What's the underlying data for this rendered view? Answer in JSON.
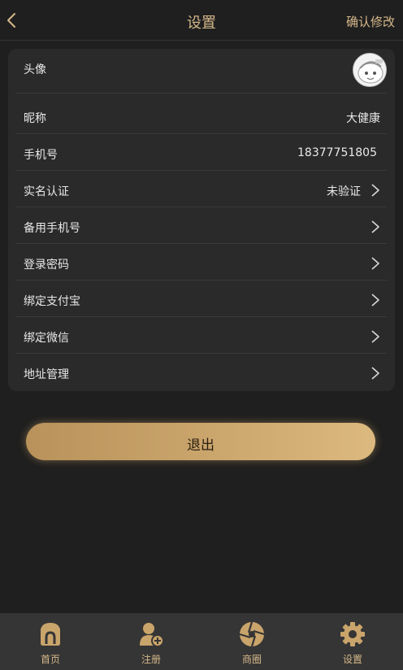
{
  "header": {
    "title": "设置",
    "confirm_label": "确认修改"
  },
  "settings": {
    "avatar_label": "头像",
    "nickname_label": "昵称",
    "nickname_value": "大健康",
    "phone_label": "手机号",
    "phone_value": "18377751805",
    "realname_label": "实名认证",
    "realname_value": "未验证",
    "backup_phone_label": "备用手机号",
    "password_label": "登录密码",
    "alipay_label": "绑定支付宝",
    "wechat_label": "绑定微信",
    "address_label": "地址管理"
  },
  "logout_label": "退出",
  "tabbar": {
    "items": [
      {
        "label": "首页",
        "icon": "home-icon"
      },
      {
        "label": "注册",
        "icon": "add-user-icon"
      },
      {
        "label": "商圈",
        "icon": "aperture-icon"
      },
      {
        "label": "设置",
        "icon": "gear-icon"
      }
    ]
  },
  "colors": {
    "accent": "#d5b88a",
    "background": "#1f1f1f",
    "card": "#2a2a2a",
    "tabbar": "#353535"
  }
}
